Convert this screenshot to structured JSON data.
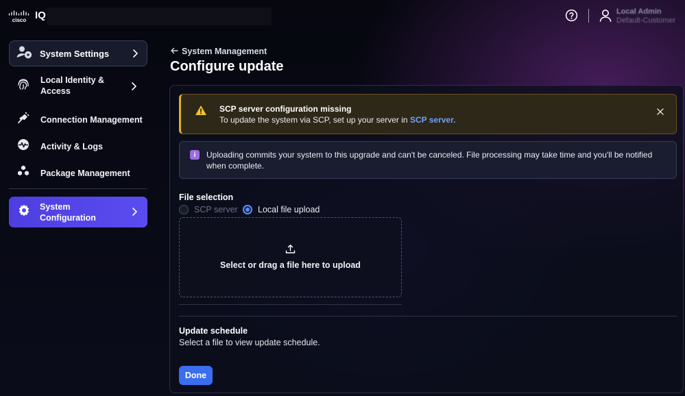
{
  "topbar": {
    "logo_text": "cisco",
    "app_name": "IQ",
    "user_name": "Local Admin",
    "user_org": "Default-Customer"
  },
  "sidebar": {
    "settings_button": "System Settings",
    "items": [
      {
        "label_line1": "Local Identity &",
        "label_line2": "Access",
        "icon": "fingerprint-icon"
      },
      {
        "label": "Connection Management",
        "icon": "plug-icon"
      },
      {
        "label": "Activity & Logs",
        "icon": "activity-icon"
      },
      {
        "label": "Package Management",
        "icon": "packages-icon"
      }
    ],
    "active_item": {
      "label_line1": "System",
      "label_line2": "Configuration",
      "icon": "gear-icon"
    }
  },
  "main": {
    "breadcrumb": "System Management",
    "title": "Configure update",
    "warning": {
      "title": "SCP server configuration missing",
      "body": "To update the system via SCP, set up your server in",
      "link": "SCP server."
    },
    "info": {
      "text": "Uploading commits your system to this upgrade and can't be canceled. File processing may take time and you'll be notified when complete."
    },
    "file_selection": {
      "label": "File selection",
      "option_scp": "SCP server",
      "option_local": "Local file upload",
      "selected": "Local file upload",
      "dropzone_text": "Select or drag a file here to upload"
    },
    "update_schedule": {
      "label": "Update schedule",
      "text": "Select a file to view update schedule."
    },
    "done_label": "Done"
  },
  "colors": {
    "accent": "#5a4cf0",
    "primary_button": "#3a6df0",
    "warning": "#e0b02a",
    "link": "#6fa0ff",
    "info": "#9b6ee0"
  }
}
